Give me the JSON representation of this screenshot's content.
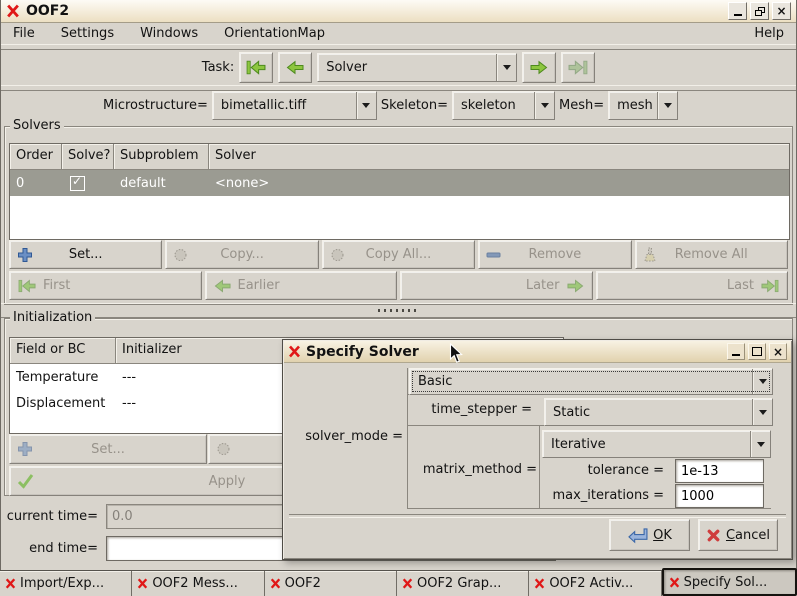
{
  "window": {
    "title": "OOF2"
  },
  "menubar": {
    "items": [
      "File",
      "Settings",
      "Windows",
      "OrientationMap"
    ],
    "help": "Help"
  },
  "task": {
    "label": "Task:",
    "selected": "Solver"
  },
  "context": {
    "microstructure_label": "Microstructure=",
    "microstructure_value": "bimetallic.tiff",
    "skeleton_label": "Skeleton=",
    "skeleton_value": "skeleton",
    "mesh_label": "Mesh=",
    "mesh_value": "mesh"
  },
  "solvers": {
    "legend": "Solvers",
    "columns": [
      "Order",
      "Solve?",
      "Subproblem",
      "Solver"
    ],
    "row": {
      "order": "0",
      "checked": true,
      "subproblem": "default",
      "solver": "<none>"
    },
    "buttons": {
      "set": "Set...",
      "copy": "Copy...",
      "copy_all": "Copy All...",
      "remove": "Remove",
      "remove_all": "Remove All"
    },
    "nav": {
      "first": "First",
      "earlier": "Earlier",
      "later": "Later",
      "last": "Last"
    }
  },
  "initialization": {
    "legend": "Initialization",
    "columns": [
      "Field or BC",
      "Initializer"
    ],
    "rows": [
      {
        "field": "Temperature",
        "initializer": "---"
      },
      {
        "field": "Displacement",
        "initializer": "---"
      }
    ],
    "set_label": "Set...",
    "apply_label": "Apply"
  },
  "times": {
    "current_label": "current time=",
    "current_value": "0.0",
    "end_label": "end time=",
    "end_value": ""
  },
  "dialog": {
    "title": "Specify Solver",
    "solver_mode_label": "solver_mode =",
    "mode_value": "Basic",
    "time_stepper_label": "time_stepper =",
    "time_stepper_value": "Static",
    "matrix_method_label": "matrix_method =",
    "matrix_method_value": "Iterative",
    "tolerance_label": "tolerance =",
    "tolerance_value": "1e-13",
    "max_iterations_label": "max_iterations =",
    "max_iterations_value": "1000",
    "ok_u": "O",
    "ok_rest": "K",
    "cancel_u": "C",
    "cancel_rest": "ancel"
  },
  "taskbar": {
    "tabs": [
      {
        "label": "Import/Exp..."
      },
      {
        "label": "OOF2 Mess..."
      },
      {
        "label": "OOF2"
      },
      {
        "label": "OOF2 Grap..."
      },
      {
        "label": "OOF2 Activ..."
      },
      {
        "label": "Specify Sol..."
      }
    ]
  }
}
